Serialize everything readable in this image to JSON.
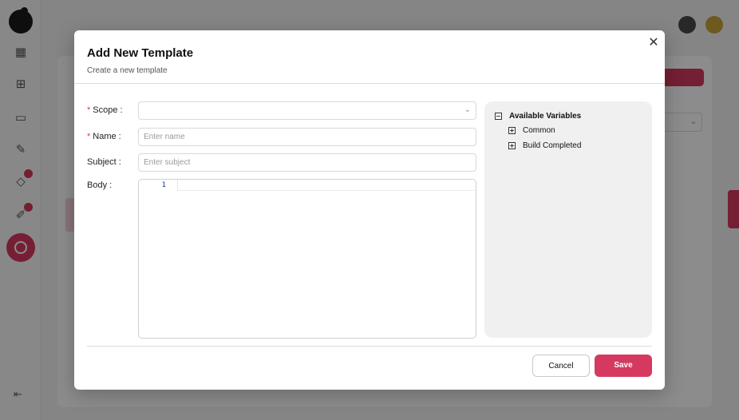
{
  "modal": {
    "title": "Add New Template",
    "subtitle": "Create a new template",
    "close_icon": "close-icon",
    "fields": {
      "scope": {
        "label": "Scope",
        "required": true,
        "value": "",
        "placeholder": ""
      },
      "name": {
        "label": "Name",
        "required": true,
        "value": "",
        "placeholder": "Enter name"
      },
      "subject": {
        "label": "Subject",
        "required": false,
        "value": "",
        "placeholder": "Enter subject"
      },
      "body": {
        "label": "Body",
        "required": false,
        "line_numbers": [
          "1"
        ]
      }
    },
    "variables": {
      "title": "Available Variables",
      "items": [
        {
          "label": "Common"
        },
        {
          "label": "Build Completed"
        }
      ]
    },
    "buttons": {
      "cancel": "Cancel",
      "save": "Save"
    }
  },
  "colors": {
    "accent": "#d6395f",
    "overlay": "rgba(0,0,0,0.45)",
    "variables_panel": "#f1f0f1"
  }
}
